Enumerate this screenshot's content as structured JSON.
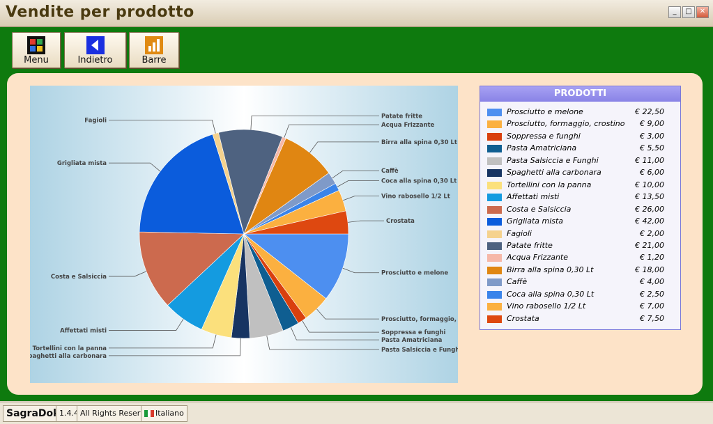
{
  "window": {
    "title": "Vendite per prodotto",
    "minimize_glyph": "_",
    "maximize_glyph": "□",
    "close_glyph": "✕"
  },
  "toolbar": {
    "menu_label": "Menu",
    "menu_icon": "grid-icon",
    "back_label": "Indietro",
    "back_icon": "back-arrow-icon",
    "bars_label": "Barre",
    "bars_icon": "bar-chart-icon"
  },
  "legend": {
    "title": "PRODOTTI"
  },
  "statusbar": {
    "app": "SagraDok",
    "version": "1.4.4",
    "rights": "All Rights Reserved",
    "language": "Italiano"
  },
  "chart_data": {
    "type": "pie",
    "categories": [
      "Prosciutto e melone",
      "Prosciutto, formaggio, crostino",
      "Soppressa e funghi",
      "Pasta Amatriciana",
      "Pasta Salsiccia e Funghi",
      "Spaghetti alla carbonara",
      "Tortellini con la panna",
      "Affettati misti",
      "Costa e Salsiccia",
      "Grigliata mista",
      "Fagioli",
      "Patate fritte",
      "Acqua Frizzante",
      "Birra alla spina 0,30 Lt",
      "Caffè",
      "Coca alla spina 0,30 Lt",
      "Vino rabosello 1/2 Lt",
      "Crostata"
    ],
    "values": [
      22.5,
      9.0,
      3.0,
      5.5,
      11.0,
      6.0,
      10.0,
      13.5,
      26.0,
      42.0,
      2.0,
      21.0,
      1.2,
      18.0,
      4.0,
      2.5,
      7.0,
      7.5
    ],
    "value_labels": [
      "€ 22,50",
      "€ 9,00",
      "€ 3,00",
      "€ 5,50",
      "€ 11,00",
      "€ 6,00",
      "€ 10,00",
      "€ 13,50",
      "€ 26,00",
      "€ 42,00",
      "€ 2,00",
      "€ 21,00",
      "€ 1,20",
      "€ 18,00",
      "€ 4,00",
      "€ 2,50",
      "€ 7,00",
      "€ 7,50"
    ],
    "colors": [
      "#4d8ff0",
      "#fbb040",
      "#d9400e",
      "#0f5e91",
      "#c0c0c0",
      "#173462",
      "#fbe07c",
      "#149be0",
      "#cc6a4e",
      "#0b5cdc",
      "#f5d28e",
      "#4e6280",
      "#f6b8a8",
      "#e08612",
      "#7f9ac8",
      "#3a84ea",
      "#fbb040",
      "#de4810"
    ],
    "legend_position": "right",
    "title": ""
  }
}
